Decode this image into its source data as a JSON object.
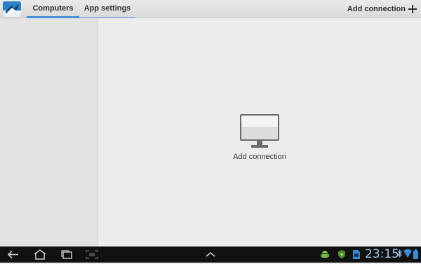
{
  "action_bar": {
    "app_icon": "app-logo-icon",
    "tabs": [
      {
        "label": "Computers",
        "selected": true
      },
      {
        "label": "App settings",
        "selected": false
      }
    ],
    "add_connection_label": "Add connection",
    "add_icon": "plus-icon",
    "accent_color": "#4a90d9"
  },
  "main": {
    "empty_state_label": "Add connection",
    "empty_state_icon": "monitor-icon"
  },
  "system_bar": {
    "nav_icons": [
      "back-icon",
      "home-icon",
      "recent-apps-icon",
      "screenshot-icon",
      "up-chevron-icon"
    ],
    "status_icons": [
      "android-debug-icon",
      "shield-icon",
      "sd-card-icon",
      "bluetooth-icon",
      "wifi-icon",
      "battery-icon"
    ],
    "time": "23:15",
    "clock_color": "#9fc4e8"
  }
}
